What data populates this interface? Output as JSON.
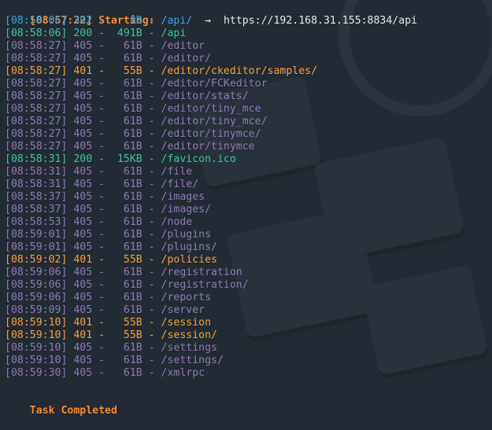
{
  "colors": {
    "background": "#222a33",
    "status_200": "#3ac59d",
    "status_302": "#3ba7e8",
    "status_401": "#f0a040",
    "status_405": "#8f79b3",
    "heading": "#f58a2c",
    "redirect_target": "#e8e8e8"
  },
  "header": {
    "timestamp": "[08:57:22]",
    "label": "Starting:"
  },
  "entries": [
    {
      "ts": "[08:58:06]",
      "status": "302",
      "size": "0B",
      "path": "/api/",
      "redirect": "→  https://192.168.31.155:8834/api"
    },
    {
      "ts": "[08:58:06]",
      "status": "200",
      "size": "491B",
      "path": "/api",
      "redirect": ""
    },
    {
      "ts": "[08:58:27]",
      "status": "405",
      "size": "61B",
      "path": "/editor",
      "redirect": ""
    },
    {
      "ts": "[08:58:27]",
      "status": "405",
      "size": "61B",
      "path": "/editor/",
      "redirect": ""
    },
    {
      "ts": "[08:58:27]",
      "status": "401",
      "size": "55B",
      "path": "/editor/ckeditor/samples/",
      "redirect": ""
    },
    {
      "ts": "[08:58:27]",
      "status": "405",
      "size": "61B",
      "path": "/editor/FCKeditor",
      "redirect": ""
    },
    {
      "ts": "[08:58:27]",
      "status": "405",
      "size": "61B",
      "path": "/editor/stats/",
      "redirect": ""
    },
    {
      "ts": "[08:58:27]",
      "status": "405",
      "size": "61B",
      "path": "/editor/tiny_mce",
      "redirect": ""
    },
    {
      "ts": "[08:58:27]",
      "status": "405",
      "size": "61B",
      "path": "/editor/tiny_mce/",
      "redirect": ""
    },
    {
      "ts": "[08:58:27]",
      "status": "405",
      "size": "61B",
      "path": "/editor/tinymce/",
      "redirect": ""
    },
    {
      "ts": "[08:58:27]",
      "status": "405",
      "size": "61B",
      "path": "/editor/tinymce",
      "redirect": ""
    },
    {
      "ts": "[08:58:31]",
      "status": "200",
      "size": "15KB",
      "path": "/favicon.ico",
      "redirect": ""
    },
    {
      "ts": "[08:58:31]",
      "status": "405",
      "size": "61B",
      "path": "/file",
      "redirect": ""
    },
    {
      "ts": "[08:58:31]",
      "status": "405",
      "size": "61B",
      "path": "/file/",
      "redirect": ""
    },
    {
      "ts": "[08:58:37]",
      "status": "405",
      "size": "61B",
      "path": "/images",
      "redirect": ""
    },
    {
      "ts": "[08:58:37]",
      "status": "405",
      "size": "61B",
      "path": "/images/",
      "redirect": ""
    },
    {
      "ts": "[08:58:53]",
      "status": "405",
      "size": "61B",
      "path": "/node",
      "redirect": ""
    },
    {
      "ts": "[08:59:01]",
      "status": "405",
      "size": "61B",
      "path": "/plugins",
      "redirect": ""
    },
    {
      "ts": "[08:59:01]",
      "status": "405",
      "size": "61B",
      "path": "/plugins/",
      "redirect": ""
    },
    {
      "ts": "[08:59:02]",
      "status": "401",
      "size": "55B",
      "path": "/policies",
      "redirect": ""
    },
    {
      "ts": "[08:59:06]",
      "status": "405",
      "size": "61B",
      "path": "/registration",
      "redirect": ""
    },
    {
      "ts": "[08:59:06]",
      "status": "405",
      "size": "61B",
      "path": "/registration/",
      "redirect": ""
    },
    {
      "ts": "[08:59:06]",
      "status": "405",
      "size": "61B",
      "path": "/reports",
      "redirect": ""
    },
    {
      "ts": "[08:59:09]",
      "status": "405",
      "size": "61B",
      "path": "/server",
      "redirect": ""
    },
    {
      "ts": "[08:59:10]",
      "status": "401",
      "size": "55B",
      "path": "/session",
      "redirect": ""
    },
    {
      "ts": "[08:59:10]",
      "status": "401",
      "size": "55B",
      "path": "/session/",
      "redirect": ""
    },
    {
      "ts": "[08:59:10]",
      "status": "405",
      "size": "61B",
      "path": "/settings",
      "redirect": ""
    },
    {
      "ts": "[08:59:10]",
      "status": "405",
      "size": "61B",
      "path": "/settings/",
      "redirect": ""
    },
    {
      "ts": "[08:59:30]",
      "status": "405",
      "size": "61B",
      "path": "/xmlrpc",
      "redirect": ""
    }
  ],
  "footer": {
    "label": "Task Completed"
  }
}
